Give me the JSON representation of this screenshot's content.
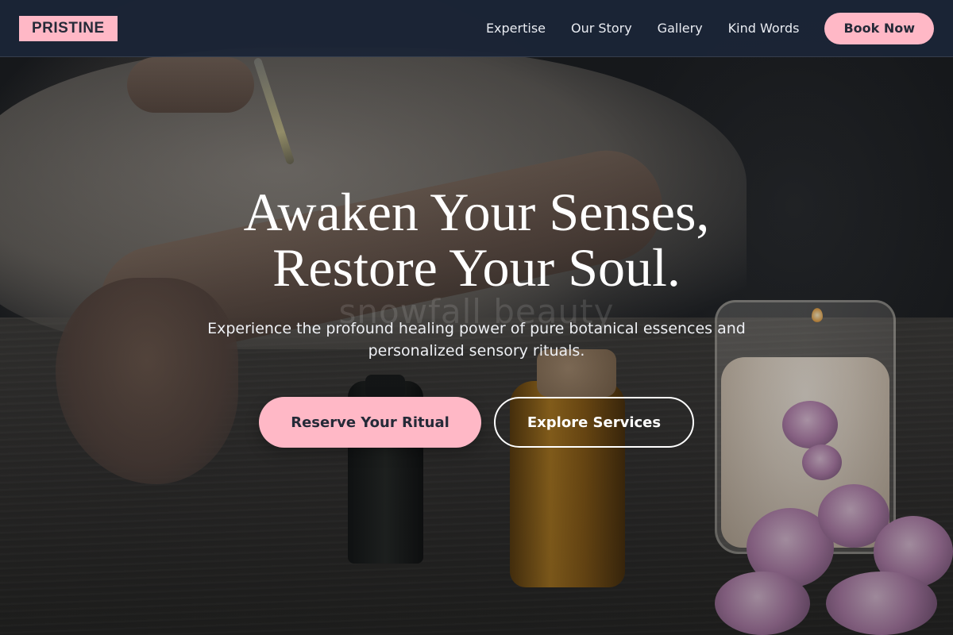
{
  "brand": {
    "logo_text": "PRISTINE"
  },
  "nav": {
    "links": [
      "Expertise",
      "Our Story",
      "Gallery",
      "Kind Words"
    ],
    "cta_label": "Book Now"
  },
  "hero": {
    "headline_line1": "Awaken Your Senses,",
    "headline_line2": "Restore Your Soul.",
    "subtitle": "Experience the profound healing power of pure botanical essences and personalized sensory rituals.",
    "watermark": "snowfall beauty",
    "primary_cta": "Reserve Your Ritual",
    "secondary_cta": "Explore Services"
  },
  "colors": {
    "accent_pink": "#ffb8c6",
    "nav_background": "#1b2436",
    "dark_text": "#252a38"
  }
}
